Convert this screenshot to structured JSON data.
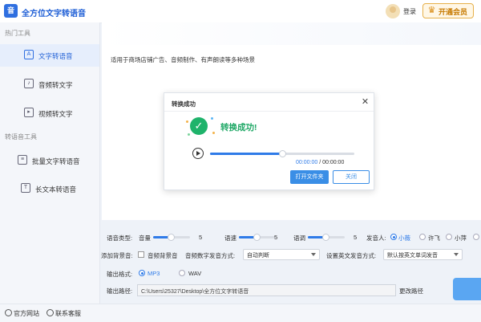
{
  "app": {
    "title": "全方位文字转语音",
    "logo_letter": "音"
  },
  "header": {
    "login_label": "登录",
    "vip_label": "开通会员"
  },
  "sidebar": {
    "section1_title": "热门工具",
    "items1": [
      {
        "label": "文字转语音",
        "active": true
      },
      {
        "label": "音频转文字",
        "active": false
      },
      {
        "label": "视频转文字",
        "active": false
      }
    ],
    "section2_title": "转语音工具",
    "items2": [
      {
        "label": "批量文字转语音"
      },
      {
        "label": "长文本转语音"
      }
    ]
  },
  "bottom": {
    "website_label": "官方网站",
    "support_label": "联系客服"
  },
  "main": {
    "usage_text": "适用于商场店铺广告、音频制作、有声朗读等多种场景"
  },
  "dialog": {
    "title": "转换成功",
    "close_symbol": "✕",
    "success_text": "转换成功!",
    "progress_fraction": 0.5,
    "time_current": "00:00:00",
    "time_sep": " / ",
    "time_total": "00:00:00",
    "open_folder_label": "打开文件夹",
    "close_label": "关闭"
  },
  "settings": {
    "voice_type_label": "语音类型:",
    "volume_label": "音量",
    "volume_value": "5",
    "speed_label": "语速",
    "speed_value": "5",
    "pitch_label": "语调",
    "pitch_value": "5",
    "speaker_label": "发音人:",
    "speakers": [
      {
        "label": "小薇",
        "selected": true
      },
      {
        "label": "许飞",
        "selected": false
      },
      {
        "label": "小萍",
        "selected": false
      }
    ],
    "bgm_label": "添加背景音:",
    "bgm_checkbox_label": "音频背景音",
    "digit_mode_label": "音频数字发音方式:",
    "digit_mode_value": "自动判断",
    "english_mode_label": "设置英文发音方式:",
    "english_mode_value": "默认按英文单词发音",
    "format_label": "输出格式:",
    "formats": [
      {
        "label": "MP3",
        "selected": true
      },
      {
        "label": "WAV",
        "selected": false
      }
    ],
    "path_label": "输出路径:",
    "path_value": "C:\\Users\\25327\\Desktop\\全方位文字转语音",
    "change_path_label": "更改路径"
  },
  "colors": {
    "accent": "#2f7be8",
    "success": "#1fb36b",
    "vip": "#d98b13"
  }
}
